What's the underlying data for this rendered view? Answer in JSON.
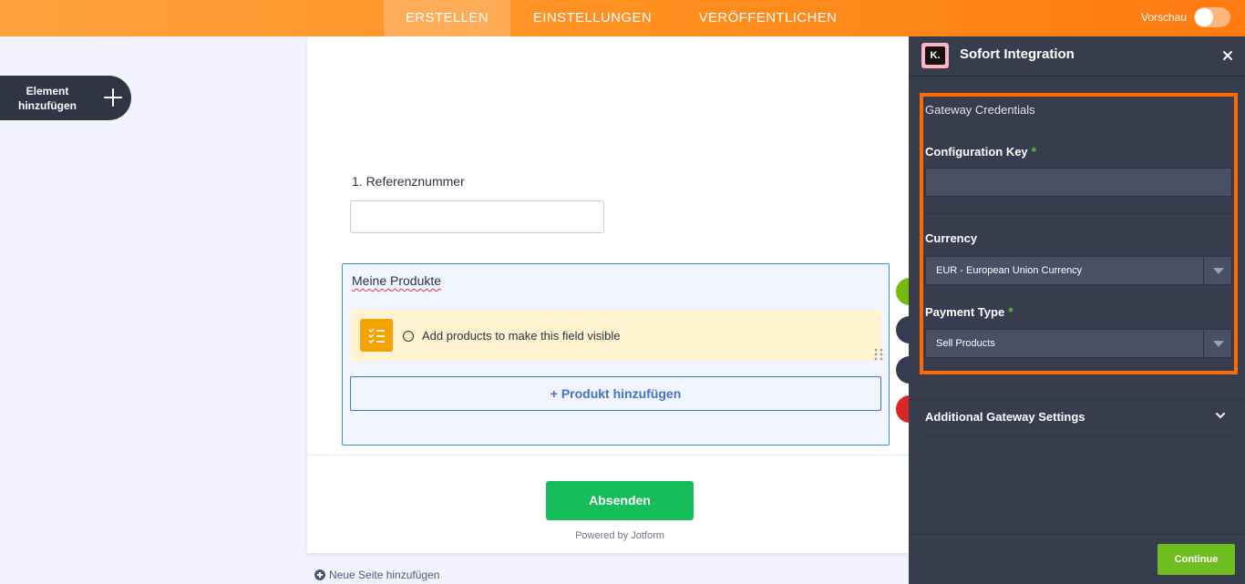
{
  "topbar": {
    "tabs": [
      {
        "label": "ERSTELLEN",
        "active": true
      },
      {
        "label": "EINSTELLUNGEN",
        "active": false
      },
      {
        "label": "VERÖFFENTLICHEN",
        "active": false
      }
    ],
    "preview_label": "Vorschau",
    "preview_enabled": false
  },
  "sidebar": {
    "add_element_line1": "Element",
    "add_element_line2": "hinzufügen"
  },
  "form": {
    "question_label": "1. Referenznummer",
    "question_value": "",
    "product_title": "Meine Produkte",
    "notice_text": "Add products to make this field visible",
    "add_product_label": "+ Produkt hinzufügen",
    "submit_label": "Absenden",
    "powered_by": "Powered by Jotform",
    "new_page_label": "Neue Seite hinzufügen"
  },
  "panel": {
    "title": "Sofort Integration",
    "logo_text": "K.",
    "credentials_title": "Gateway Credentials",
    "config_key_label": "Configuration Key",
    "config_key_value": "",
    "required_mark": "*",
    "currency_label": "Currency",
    "currency_value": "EUR - European Union Currency",
    "payment_type_label": "Payment Type",
    "payment_type_value": "Sell Products",
    "additional_settings_label": "Additional Gateway Settings",
    "continue_label": "Continue"
  },
  "colors": {
    "topbar_orange": "#ff8f1f",
    "panel_bg": "#383d4e",
    "highlight_border": "#ff6a00",
    "submit_green": "#18bd5b",
    "continue_green": "#6fbe1f",
    "required_green": "#58c22b"
  }
}
